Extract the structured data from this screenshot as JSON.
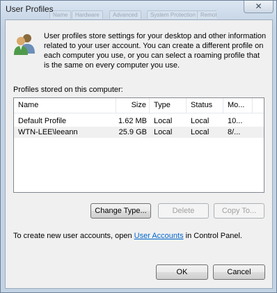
{
  "window": {
    "title": "User Profiles",
    "close_glyph": "✕",
    "background_tabs": [
      "Name",
      "Hardware",
      "Advanced",
      "System Protection",
      "Remote"
    ]
  },
  "intro_text": "User profiles store settings for your desktop and other information related to your user account. You can create a different profile on each computer you use, or you can select a roaming profile that is the same on every computer you use.",
  "profiles": {
    "caption": "Profiles stored on this computer:",
    "columns": {
      "name": "Name",
      "size": "Size",
      "type": "Type",
      "status": "Status",
      "modified": "Mo..."
    },
    "rows": [
      {
        "name": "Default Profile",
        "size": "1.62 MB",
        "type": "Local",
        "status": "Local",
        "modified": "10..."
      },
      {
        "name": "WTN-LEE\\leeann",
        "size": "25.9 GB",
        "type": "Local",
        "status": "Local",
        "modified": "8/..."
      }
    ]
  },
  "buttons": {
    "change_type": "Change Type...",
    "delete": "Delete",
    "copy_to": "Copy To...",
    "ok": "OK",
    "cancel": "Cancel"
  },
  "footer": {
    "before": "To create new user accounts, open ",
    "link": "User Accounts",
    "after": " in Control Panel."
  },
  "icons": {
    "dialog_icon": "users-icon",
    "close": "close-icon"
  },
  "colors": {
    "link": "#0066cc",
    "selected_row": "#f0f0f0",
    "title_bar": "#cad8e8"
  }
}
